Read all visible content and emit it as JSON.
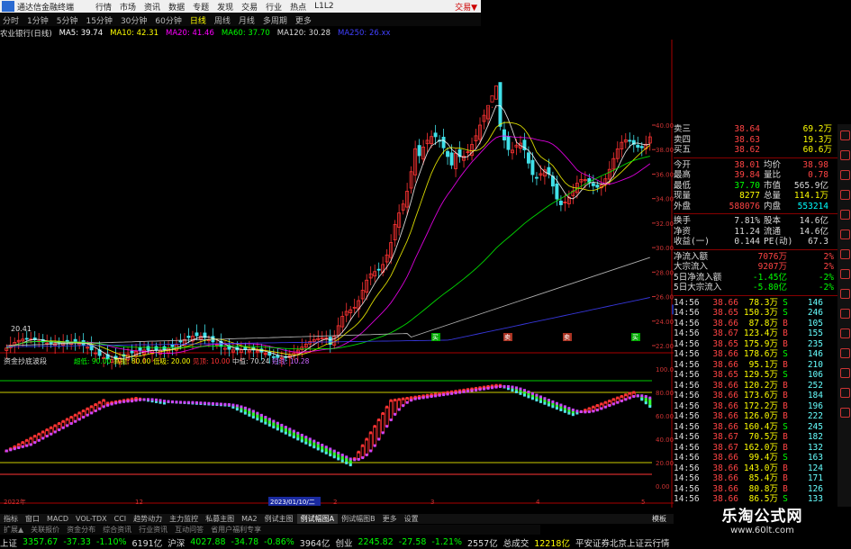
{
  "menubar": {
    "app_title": "通达信金融终端",
    "items": [
      "行情",
      "市场",
      "资讯",
      "数据",
      "专题",
      "发现",
      "交易",
      "行业",
      "热点",
      "L1L2"
    ],
    "corner": "交易▼"
  },
  "period_bar": {
    "items": [
      "分时",
      "1分钟",
      "5分钟",
      "15分钟",
      "30分钟",
      "60分钟",
      "日线",
      "周线",
      "月线",
      "多周期",
      "更多"
    ],
    "active": "日线"
  },
  "ma_legend": {
    "stock": "农业银行(日线)",
    "items": [
      {
        "text": "MA5: 39.74",
        "color": "#ffffff"
      },
      {
        "text": "MA10: 42.31",
        "color": "#ffff00"
      },
      {
        "text": "MA20: 41.46",
        "color": "#ff00ff"
      },
      {
        "text": "MA60: 37.70",
        "color": "#00ff00"
      },
      {
        "text": "MA120: 30.28",
        "color": "#dddddd"
      },
      {
        "text": "MA250: 26.xx",
        "color": "#4040ff"
      }
    ]
  },
  "price_axis": {
    "labels": [
      "40.00",
      "38.00",
      "36.00",
      "34.00",
      "32.00",
      "30.00",
      "28.00",
      "26.00",
      "24.00",
      "22.00"
    ],
    "current_price": "24.91",
    "low_label": "20.41"
  },
  "indicator": {
    "title": "资金抄底波段",
    "legend": [
      {
        "text": "超低: 90.00",
        "color": "#00ff00"
      },
      {
        "text": "高抛: 80.00",
        "color": "#ffff00"
      },
      {
        "text": "低吸: 20.00",
        "color": "#ffff00"
      },
      {
        "text": "见顶: 10.00",
        "color": "#ff3333"
      },
      {
        "text": "中值: 70.24",
        "color": "#dddddd"
      },
      {
        "text": "短线: 10.28",
        "color": "#cc66ff"
      }
    ],
    "axis_labels": [
      "100.00",
      "80.00",
      "60.00",
      "40.00",
      "20.00",
      "0.00"
    ],
    "signals": [
      "买",
      "卖",
      "卖",
      "买"
    ]
  },
  "date_axis": {
    "labels": [
      "2022年",
      "12",
      "2023/01/10/二",
      "2",
      "3",
      "4",
      "5"
    ]
  },
  "quote": {
    "asks": [
      {
        "label": "卖三",
        "price": "38.64",
        "vol": "69.2万"
      },
      {
        "label": "卖四",
        "price": "38.63",
        "vol": "19.3万"
      },
      {
        "label": "买五",
        "price": "38.62",
        "vol": "60.6万"
      }
    ],
    "stats": [
      {
        "l1": "今开",
        "v1": "38.01",
        "c1": "#ff4444",
        "l2": "均价",
        "v2": "38.98",
        "c2": "#ff4444"
      },
      {
        "l1": "最高",
        "v1": "39.84",
        "c1": "#ff4444",
        "l2": "量比",
        "v2": "0.78",
        "c2": "#ff4444"
      },
      {
        "l1": "最低",
        "v1": "37.70",
        "c1": "#00ff00",
        "l2": "市值",
        "v2": "565.9亿",
        "c2": "#dddddd"
      },
      {
        "l1": "现量",
        "v1": "8277",
        "c1": "#ffff00",
        "l2": "总量",
        "v2": "114.1万",
        "c2": "#ffff00"
      },
      {
        "l1": "外盘",
        "v1": "588076",
        "c1": "#ff4444",
        "l2": "内盘",
        "v2": "553214",
        "c2": "#00ffff"
      }
    ],
    "stats2": [
      {
        "l1": "换手",
        "v1": "7.81%",
        "c1": "#dddddd",
        "l2": "股本",
        "v2": "14.6亿",
        "c2": "#dddddd"
      },
      {
        "l1": "净资",
        "v1": "11.24",
        "c1": "#dddddd",
        "l2": "流通",
        "v2": "14.6亿",
        "c2": "#dddddd"
      },
      {
        "l1": "收益(一)",
        "v1": "0.144",
        "c1": "#dddddd",
        "l2": "PE(动)",
        "v2": "67.3",
        "c2": "#dddddd"
      }
    ],
    "flows": [
      {
        "label": "净流入额",
        "val": "7076万",
        "pct": "2%",
        "c": "#ff4444"
      },
      {
        "label": "大宗流入",
        "val": "9207万",
        "pct": "2%",
        "c": "#ff4444"
      },
      {
        "label": "5日净流入额",
        "val": "-1.45亿",
        "pct": "-2%",
        "c": "#00ff00"
      },
      {
        "label": "5日大宗流入",
        "val": "-5.80亿",
        "pct": "-2%",
        "c": "#00ff00"
      }
    ]
  },
  "ticks": [
    {
      "t": "14:56",
      "p": "38.66",
      "v": "78.3万",
      "bs": "S",
      "n": "146",
      "c": "#00ff00"
    },
    {
      "t": "14:56",
      "p": "38.65",
      "v": "150.3万",
      "bs": "S",
      "n": "246",
      "c": "#00ff00"
    },
    {
      "t": "14:56",
      "p": "38.66",
      "v": "87.8万",
      "bs": "B",
      "n": "105",
      "c": "#ff4444"
    },
    {
      "t": "14:56",
      "p": "38.67",
      "v": "123.4万",
      "bs": "B",
      "n": "155",
      "c": "#ff4444"
    },
    {
      "t": "14:56",
      "p": "38.65",
      "v": "175.9万",
      "bs": "B",
      "n": "235",
      "c": "#ff4444"
    },
    {
      "t": "14:56",
      "p": "38.66",
      "v": "178.6万",
      "bs": "S",
      "n": "146",
      "c": "#00ff00"
    },
    {
      "t": "14:56",
      "p": "38.66",
      "v": "95.1万",
      "bs": "B",
      "n": "210",
      "c": "#ff4444"
    },
    {
      "t": "14:56",
      "p": "38.65",
      "v": "129.5万",
      "bs": "S",
      "n": "106",
      "c": "#00ff00"
    },
    {
      "t": "14:56",
      "p": "38.66",
      "v": "120.2万",
      "bs": "B",
      "n": "252",
      "c": "#ff4444"
    },
    {
      "t": "14:56",
      "p": "38.66",
      "v": "173.6万",
      "bs": "B",
      "n": "184",
      "c": "#ff4444"
    },
    {
      "t": "14:56",
      "p": "38.66",
      "v": "172.2万",
      "bs": "B",
      "n": "196",
      "c": "#ff4444"
    },
    {
      "t": "14:56",
      "p": "38.66",
      "v": "126.0万",
      "bs": "B",
      "n": "222",
      "c": "#ff4444"
    },
    {
      "t": "14:56",
      "p": "38.66",
      "v": "160.4万",
      "bs": "S",
      "n": "245",
      "c": "#00ff00"
    },
    {
      "t": "14:56",
      "p": "38.67",
      "v": "70.5万",
      "bs": "B",
      "n": "182",
      "c": "#ff4444"
    },
    {
      "t": "14:56",
      "p": "38.67",
      "v": "162.0万",
      "bs": "B",
      "n": "132",
      "c": "#ff4444"
    },
    {
      "t": "14:56",
      "p": "38.66",
      "v": "99.4万",
      "bs": "S",
      "n": "163",
      "c": "#00ff00"
    },
    {
      "t": "14:56",
      "p": "38.66",
      "v": "143.0万",
      "bs": "B",
      "n": "124",
      "c": "#ff4444"
    },
    {
      "t": "14:56",
      "p": "38.66",
      "v": "85.4万",
      "bs": "B",
      "n": "171",
      "c": "#ff4444"
    },
    {
      "t": "14:56",
      "p": "38.66",
      "v": "80.8万",
      "bs": "B",
      "n": "126",
      "c": "#ff4444"
    },
    {
      "t": "14:56",
      "p": "38.66",
      "v": "86.5万",
      "bs": "S",
      "n": "133",
      "c": "#00ff00"
    }
  ],
  "bottom_tabs": [
    "指标",
    "窗口",
    "MACD",
    "VOL-TDX",
    "CCI",
    "趋势动力",
    "主力监控",
    "私募主图",
    "MA2",
    "例试主图",
    "例试幅图A",
    "例试幅图B",
    "更多",
    "设置"
  ],
  "bottom_tabs_active": "例试幅图A",
  "bottom_tabs2": [
    "扩展▲",
    "关联报价",
    "资金分布",
    "综合资讯",
    "行业资讯",
    "互动问答",
    "省用户福利专享"
  ],
  "section_right": "模板",
  "ticker": [
    {
      "text": "上证",
      "c": "#dddddd"
    },
    {
      "text": "3357.67",
      "c": "#00ff00"
    },
    {
      "text": "-37.33",
      "c": "#00ff00"
    },
    {
      "text": "-1.10%",
      "c": "#00ff00"
    },
    {
      "text": "6191亿",
      "c": "#dddddd"
    },
    {
      "text": "沪深",
      "c": "#dddddd"
    },
    {
      "text": "4027.88",
      "c": "#00ff00"
    },
    {
      "text": "-34.78",
      "c": "#00ff00"
    },
    {
      "text": "-0.86%",
      "c": "#00ff00"
    },
    {
      "text": "3964亿",
      "c": "#dddddd"
    },
    {
      "text": "创业",
      "c": "#dddddd"
    },
    {
      "text": "2245.82",
      "c": "#00ff00"
    },
    {
      "text": "-27.58",
      "c": "#00ff00"
    },
    {
      "text": "-1.21%",
      "c": "#00ff00"
    },
    {
      "text": "2557亿",
      "c": "#dddddd"
    },
    {
      "text": "总成交",
      "c": "#dddddd"
    },
    {
      "text": "12218亿",
      "c": "#ffff00"
    },
    {
      "text": "平安证券北京上证云行情",
      "c": "#dddddd"
    }
  ],
  "watermark": {
    "title": "乐淘公式网",
    "url": "www.60lt.com"
  },
  "colors": {
    "up": "#ff3333",
    "down": "#00ffff",
    "accent": "#ffff00"
  }
}
